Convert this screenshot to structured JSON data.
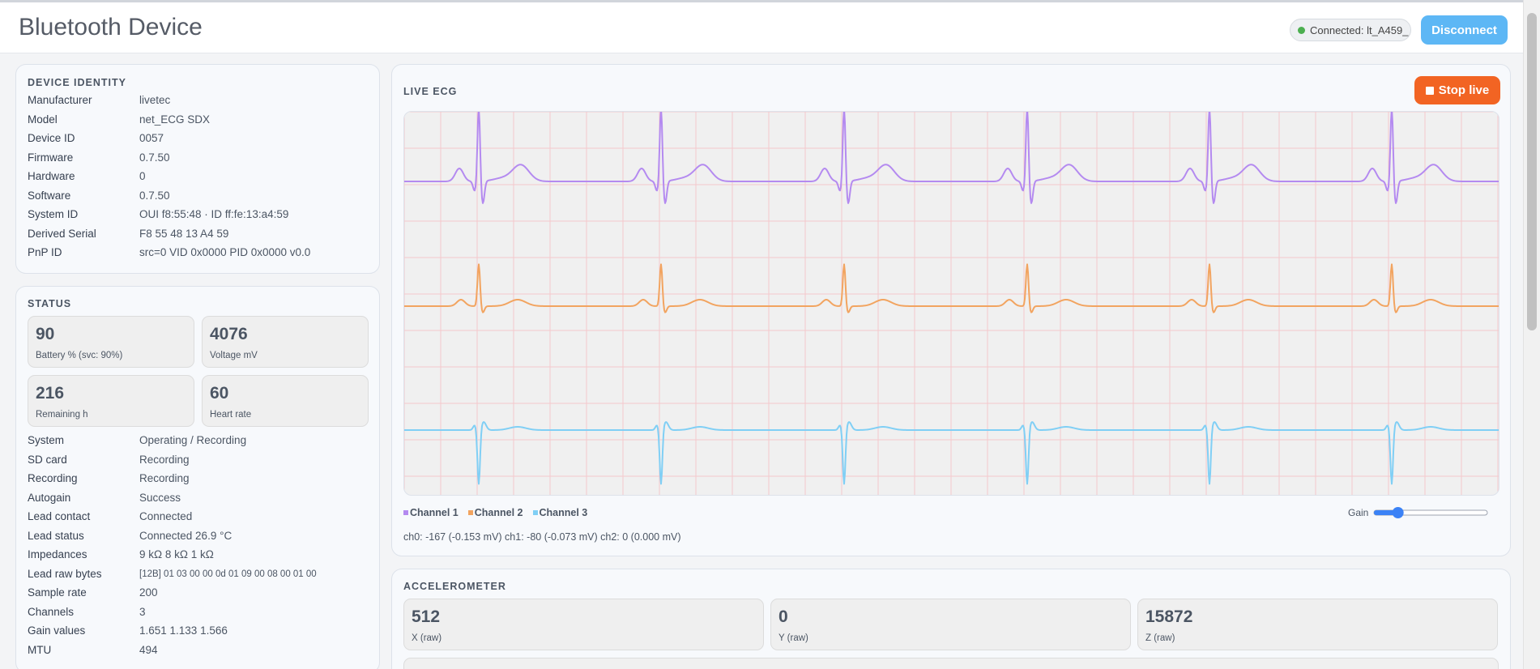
{
  "header": {
    "title": "Bluetooth Device",
    "connection_status": "Connected: lt_A459_",
    "disconnect_label": "Disconnect"
  },
  "identity": {
    "title": "DEVICE IDENTITY",
    "rows": [
      {
        "key": "Manufacturer",
        "value": "livetec"
      },
      {
        "key": "Model",
        "value": "net_ECG SDX"
      },
      {
        "key": "Device ID",
        "value": "0057"
      },
      {
        "key": "Firmware",
        "value": "0.7.50"
      },
      {
        "key": "Hardware",
        "value": "0"
      },
      {
        "key": "Software",
        "value": "0.7.50"
      },
      {
        "key": "System ID",
        "value": "OUI f8:55:48 · ID ff:fe:13:a4:59"
      },
      {
        "key": "Derived Serial",
        "value": "F8 55 48 13 A4 59"
      },
      {
        "key": "PnP ID",
        "value": "src=0 VID 0x0000 PID 0x0000 v0.0"
      }
    ]
  },
  "status": {
    "title": "STATUS",
    "tiles": [
      {
        "value": "90",
        "label": "Battery % (svc: 90%)"
      },
      {
        "value": "4076",
        "label": "Voltage mV"
      },
      {
        "value": "216",
        "label": "Remaining h"
      },
      {
        "value": "60",
        "label": "Heart rate"
      }
    ],
    "rows": [
      {
        "key": "System",
        "value": "Operating / Recording"
      },
      {
        "key": "SD card",
        "value": "Recording"
      },
      {
        "key": "Recording",
        "value": "Recording"
      },
      {
        "key": "Autogain",
        "value": "Success"
      },
      {
        "key": "Lead contact",
        "value": "Connected"
      },
      {
        "key": "Lead status",
        "value": "Connected 26.9 °C"
      },
      {
        "key": "Impedances",
        "value": "9 kΩ 8 kΩ 1 kΩ"
      },
      {
        "key": "Lead raw bytes",
        "value": "[12B] 01 03 00 00 0d 01 09 00 08 00 01 00"
      },
      {
        "key": "Sample rate",
        "value": "200"
      },
      {
        "key": "Channels",
        "value": "3"
      },
      {
        "key": "Gain values",
        "value": "1.651 1.133 1.566"
      },
      {
        "key": "MTU",
        "value": "494"
      }
    ]
  },
  "ecg": {
    "title": "LIVE ECG",
    "stop_label": "Stop live",
    "channels": [
      {
        "name": "Channel 1",
        "color": "#b48af0"
      },
      {
        "name": "Channel 2",
        "color": "#f2a460"
      },
      {
        "name": "Channel 3",
        "color": "#80cff5"
      }
    ],
    "gain_label": "Gain",
    "gain_level": 0.18,
    "readout": "ch0: -167 (-0.153 mV) ch1: -80 (-0.073 mV) ch2: 0 (0.000 mV)"
  },
  "accelerometer": {
    "title": "ACCELEROMETER",
    "tiles": [
      {
        "value": "512",
        "label": "X (raw)"
      },
      {
        "value": "0",
        "label": "Y (raw)"
      },
      {
        "value": "15872",
        "label": "Z (raw)"
      }
    ]
  },
  "colors": {
    "accent_blue": "#5db7f5",
    "stop_orange": "#f26423",
    "status_green": "#4caf50",
    "grid_pink": "#f5c8cc"
  }
}
